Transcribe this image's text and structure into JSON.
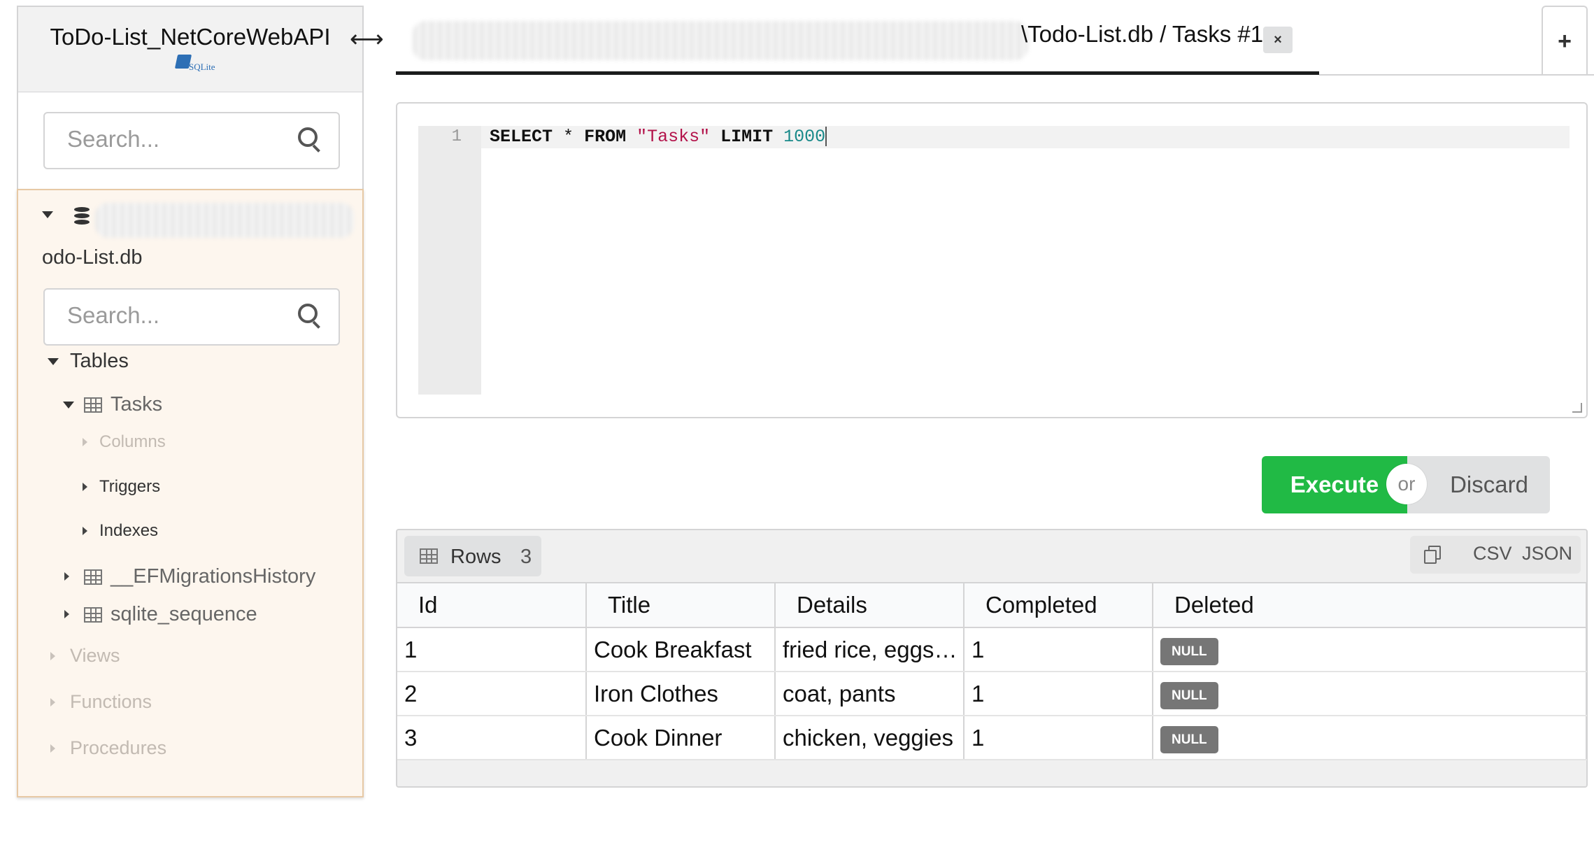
{
  "sidebar": {
    "connection_title": "ToDo-List_NetCoreWebAPI",
    "logo_text": "SQLite",
    "resize_glyph": "⟷",
    "search_placeholder": "Search...",
    "db_name_visible": "odo-List.db",
    "db_search_placeholder": "Search...",
    "tree": {
      "tables_label": "Tables",
      "tasks_label": "Tasks",
      "columns_label": "Columns",
      "triggers_label": "Triggers",
      "indexes_label": "Indexes",
      "ef_label": "__EFMigrationsHistory",
      "sqlite_seq_label": "sqlite_sequence",
      "views_label": "Views",
      "functions_label": "Functions",
      "procedures_label": "Procedures"
    }
  },
  "tabs": {
    "active_title": "\\Todo-List.db / Tasks #1",
    "close_glyph": "×",
    "new_tab_glyph": "+"
  },
  "editor": {
    "line_number": "1",
    "sql": {
      "select": "SELECT",
      "star": "*",
      "from": "FROM",
      "table": "\"Tasks\"",
      "limit": "LIMIT",
      "limit_value": "1000"
    }
  },
  "actions": {
    "execute": "Execute",
    "or": "or",
    "discard": "Discard"
  },
  "results": {
    "rows_label": "Rows",
    "rows_count": "3",
    "csv": "CSV",
    "json": "JSON",
    "columns": [
      "Id",
      "Title",
      "Details",
      "Completed",
      "Deleted"
    ],
    "rows": [
      [
        "1",
        "Cook Breakfast",
        "fried rice, eggs, s...",
        "1",
        "NULL"
      ],
      [
        "2",
        "Iron Clothes",
        "coat, pants",
        "1",
        "NULL"
      ],
      [
        "3",
        "Cook Dinner",
        "chicken, veggies",
        "1",
        "NULL"
      ]
    ]
  },
  "colors": {
    "execute_green": "#21ba45",
    "panel_bg": "#fdf6ee",
    "panel_border": "#e7c9a5",
    "null_badge": "#767676",
    "sql_string": "#b3124a",
    "sql_number": "#1a8a8a"
  },
  "icons": [
    "search-icon",
    "database-icon",
    "table-icon",
    "caret-down-icon",
    "caret-right-icon",
    "close-icon",
    "plus-icon",
    "copy-icon",
    "resize-arrow-icon"
  ]
}
